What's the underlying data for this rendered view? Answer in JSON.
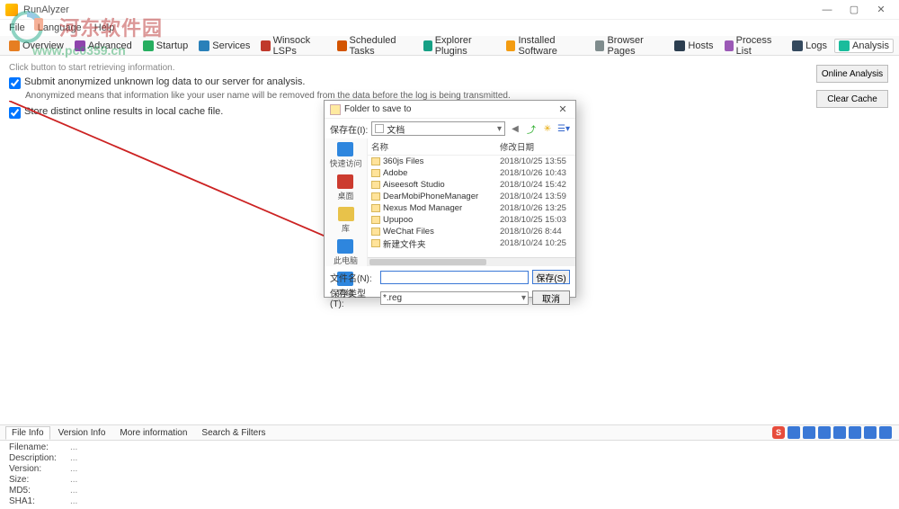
{
  "window": {
    "title": "RunAlyzer"
  },
  "menu": [
    "File",
    "Language",
    "Help"
  ],
  "toolbar": [
    {
      "label": "Overview",
      "color": "#e67e22"
    },
    {
      "label": "Advanced",
      "color": "#8e44ad"
    },
    {
      "label": "Startup",
      "color": "#27ae60"
    },
    {
      "label": "Services",
      "color": "#2980b9"
    },
    {
      "label": "Winsock LSPs",
      "color": "#c0392b"
    },
    {
      "label": "Scheduled Tasks",
      "color": "#d35400"
    },
    {
      "label": "Explorer Plugins",
      "color": "#16a085"
    },
    {
      "label": "Installed Software",
      "color": "#f39c12"
    },
    {
      "label": "Browser Pages",
      "color": "#7f8c8d"
    },
    {
      "label": "Hosts",
      "color": "#2c3e50"
    },
    {
      "label": "Process List",
      "color": "#9b59b6"
    },
    {
      "label": "Logs",
      "color": "#34495e"
    },
    {
      "label": "Analysis",
      "color": "#1abc9c",
      "active": true
    }
  ],
  "content": {
    "hint": "Click button to start retrieving information.",
    "check1": "Submit anonymized unknown log data to our server for analysis.",
    "check1_sub": "Anonymized means that information like your user name will be removed from the data before the log is being transmitted.",
    "check2": "Store distinct online results in local cache file.",
    "btn_online": "Online Analysis",
    "btn_clear": "Clear Cache"
  },
  "watermark": {
    "brand": "河东软件园",
    "url": "www.pc0359.cn"
  },
  "dialog": {
    "title": "Folder to save to",
    "save_in_label": "保存在(I):",
    "save_in_value": "文档",
    "side": [
      {
        "label": "快速访问",
        "color": "#2e86de"
      },
      {
        "label": "桌面",
        "color": "#cc3b2f"
      },
      {
        "label": "库",
        "color": "#e8c24a"
      },
      {
        "label": "此电脑",
        "color": "#2e86de"
      },
      {
        "label": "网络",
        "color": "#2e86de"
      }
    ],
    "col_name": "名称",
    "col_date": "修改日期",
    "items": [
      {
        "name": "360js Files",
        "date": "2018/10/25 13:55"
      },
      {
        "name": "Adobe",
        "date": "2018/10/26 10:43"
      },
      {
        "name": "Aiseesoft Studio",
        "date": "2018/10/24 15:42"
      },
      {
        "name": "DearMobiPhoneManager",
        "date": "2018/10/24 13:59"
      },
      {
        "name": "Nexus Mod Manager",
        "date": "2018/10/26 13:25"
      },
      {
        "name": "Upupoo",
        "date": "2018/10/25 15:03"
      },
      {
        "name": "WeChat Files",
        "date": "2018/10/26 8:44"
      },
      {
        "name": "新建文件夹",
        "date": "2018/10/24 10:25"
      }
    ],
    "filename_label": "文件名(N):",
    "filename_value": "",
    "filetype_label": "保存类型(T):",
    "filetype_value": "*.reg",
    "btn_save": "保存(S)",
    "btn_cancel": "取消"
  },
  "bottom_tabs": [
    "File Info",
    "Version Info",
    "More information",
    "Search & Filters"
  ],
  "info": [
    {
      "k": "Filename:",
      "v": "..."
    },
    {
      "k": "Description:",
      "v": "..."
    },
    {
      "k": "Version:",
      "v": "..."
    },
    {
      "k": "Size:",
      "v": "..."
    },
    {
      "k": "MD5:",
      "v": "..."
    },
    {
      "k": "SHA1:",
      "v": "..."
    }
  ],
  "ime_colors": [
    "#e74c3c",
    "#3a78d6",
    "#3a78d6",
    "#3a78d6",
    "#3a78d6",
    "#3a78d6",
    "#3a78d6",
    "#3a78d6"
  ]
}
